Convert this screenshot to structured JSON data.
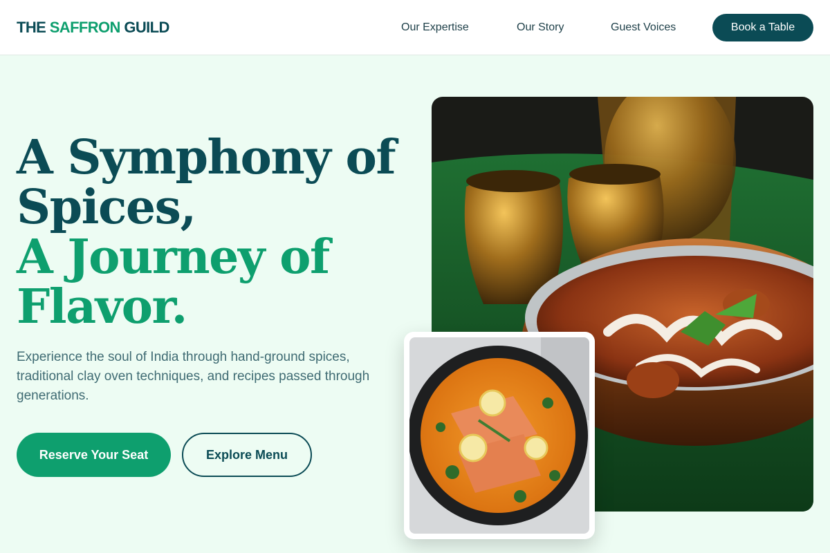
{
  "brand": {
    "logo_part1": "THE ",
    "logo_part2": "SAFFRON",
    "logo_part3": " GUILD",
    "primary_color": "#0b4b55",
    "accent_color": "#0e9f6e",
    "background_color": "#edfcf3"
  },
  "nav": {
    "items": [
      {
        "label": "Our Expertise"
      },
      {
        "label": "Our Story"
      },
      {
        "label": "Guest Voices"
      }
    ],
    "cta_label": "Book a Table"
  },
  "hero": {
    "headline_line1": "A Symphony of",
    "headline_line2": "Spices,",
    "headline_line3": "A Journey of",
    "headline_line4": "Flavor.",
    "subtext": "Experience the soul of India through hand-ground spices, traditional clay oven techniques, and recipes passed through generations.",
    "primary_button": "Reserve Your Seat",
    "secondary_button": "Explore Menu"
  },
  "images": {
    "main_alt": "Curry in a copper handi with brass cups",
    "secondary_alt": "Salmon curry in a black pan with lemon slices"
  }
}
